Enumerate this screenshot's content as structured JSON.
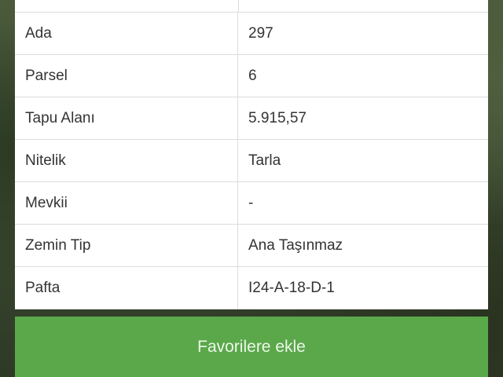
{
  "rows": [
    {
      "label": "Ada",
      "value": "297"
    },
    {
      "label": "Parsel",
      "value": "6"
    },
    {
      "label": "Tapu Alanı",
      "value": "5.915,57"
    },
    {
      "label": "Nitelik",
      "value": "Tarla"
    },
    {
      "label": "Mevkii",
      "value": "-"
    },
    {
      "label": "Zemin Tip",
      "value": "Ana Taşınmaz"
    },
    {
      "label": "Pafta",
      "value": "I24-A-18-D-1"
    }
  ],
  "button": {
    "favorite_label": "Favorilere ekle"
  },
  "colors": {
    "button_bg": "#5aa84a",
    "button_text": "#eef7ea",
    "text": "#333333",
    "divider": "#dcdcdc"
  }
}
